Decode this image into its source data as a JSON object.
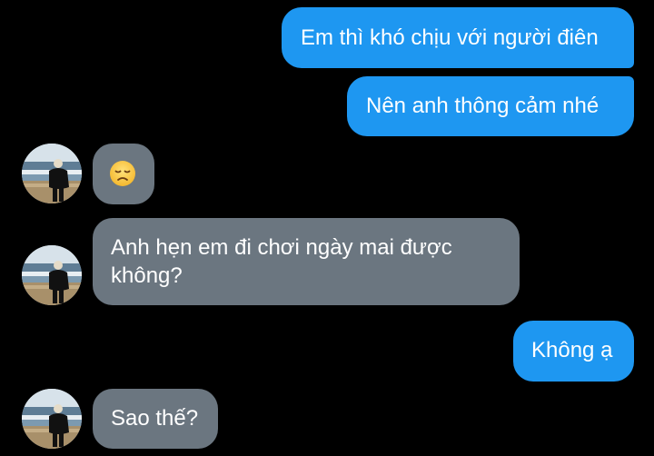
{
  "messages": [
    {
      "direction": "outgoing",
      "text": "Em thì khó chịu với người điên"
    },
    {
      "direction": "outgoing",
      "text": "Nên anh thông cảm nhé"
    },
    {
      "direction": "incoming",
      "emoji": "disappointed-face-emoji"
    },
    {
      "direction": "incoming",
      "text": "Anh hẹn em đi chơi ngày mai được\nkhông?"
    },
    {
      "direction": "outgoing",
      "text": "Không ạ"
    },
    {
      "direction": "incoming",
      "text": "Sao thế?"
    }
  ],
  "colors": {
    "background": "#000000",
    "outgoing_bubble": "#1e97f1",
    "incoming_bubble": "#6b7680",
    "text": "#ffffff"
  }
}
